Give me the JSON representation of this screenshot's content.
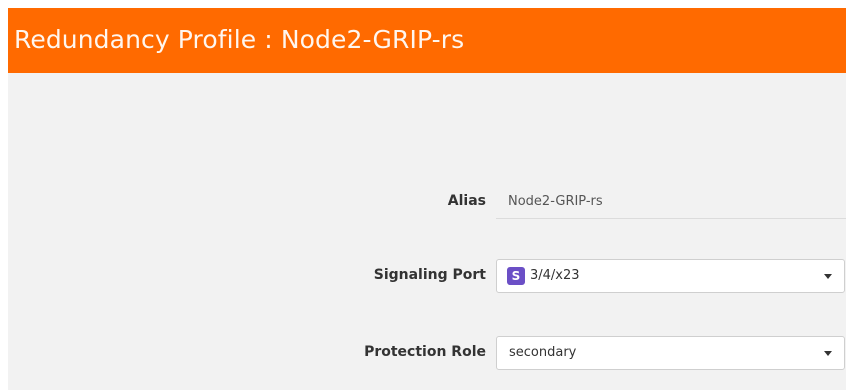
{
  "header": {
    "title": "Redundancy Profile : Node2-GRIP-rs",
    "background_color": "#ff6a00"
  },
  "form": {
    "alias": {
      "label": "Alias",
      "value": "Node2-GRIP-rs"
    },
    "signaling_port": {
      "label": "Signaling Port",
      "badge": "S",
      "badge_color": "#6b4fc6",
      "value": "3/4/x23"
    },
    "protection_role": {
      "label": "Protection Role",
      "value": "secondary"
    }
  }
}
